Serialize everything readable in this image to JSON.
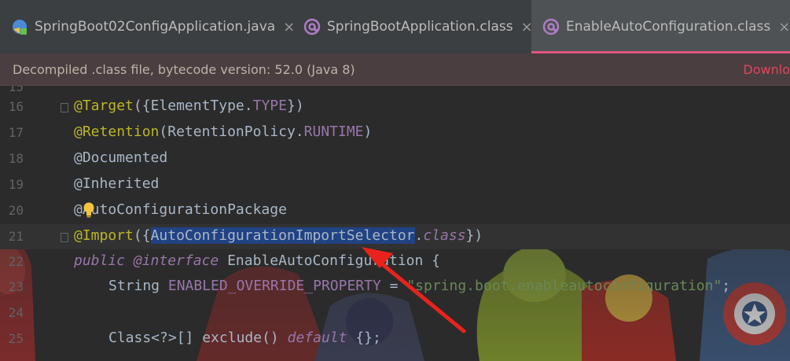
{
  "tabs": [
    {
      "label": "SpringBoot02ConfigApplication.java",
      "icon": "java-class-icon",
      "active": false
    },
    {
      "label": "SpringBootApplication.class",
      "icon": "annotation-class-icon",
      "active": false
    },
    {
      "label": "EnableAutoConfiguration.class",
      "icon": "annotation-class-icon",
      "active": true
    }
  ],
  "close_glyph": "×",
  "notice": {
    "message": "Decompiled .class file, bytecode version: 52.0 (Java 8)",
    "link": "Downlo"
  },
  "lines": [
    {
      "num": "16",
      "at": "@",
      "ann": "Target",
      "p1": "({",
      "cls": "ElementType",
      "dot": ".",
      "val": "TYPE",
      "p2": "})"
    },
    {
      "num": "17",
      "at": "@",
      "ann": "Retention",
      "p1": "(",
      "cls": "RetentionPolicy",
      "dot": ".",
      "val": "RUNTIME",
      "p2": ")"
    },
    {
      "num": "18",
      "text": "@Documented"
    },
    {
      "num": "19",
      "text": "@Inherited"
    },
    {
      "num": "20",
      "text": "@AutoConfigurationPackage"
    },
    {
      "num": "21",
      "at": "@",
      "ann": "Import",
      "p1": "({",
      "selected": "AutoConfigurationImportSelector",
      "dot": ".",
      "kw": "class",
      "p2": "})"
    },
    {
      "num": "22",
      "kw1": "public",
      "kw2": "@interface",
      "name": "EnableAutoConfiguration",
      "brace": " {"
    },
    {
      "num": "23",
      "type": "String",
      "field": "ENABLED_OVERRIDE_PROPERTY",
      "eq": " = ",
      "str": "\"spring.boot.enableautoconfiguration\"",
      "semi": ";"
    },
    {
      "num": "24",
      "text": ""
    },
    {
      "num": "25",
      "type": "Class<?>[]",
      "method": "exclude()",
      "kw": "default",
      "rest": "{};"
    }
  ],
  "colors": {
    "annotation": "#bbb529",
    "keyword": "#cc7832",
    "string": "#6a8759",
    "selection": "#214283",
    "active_tab_underline": "#e0557f",
    "arrow": "#e8231c"
  }
}
